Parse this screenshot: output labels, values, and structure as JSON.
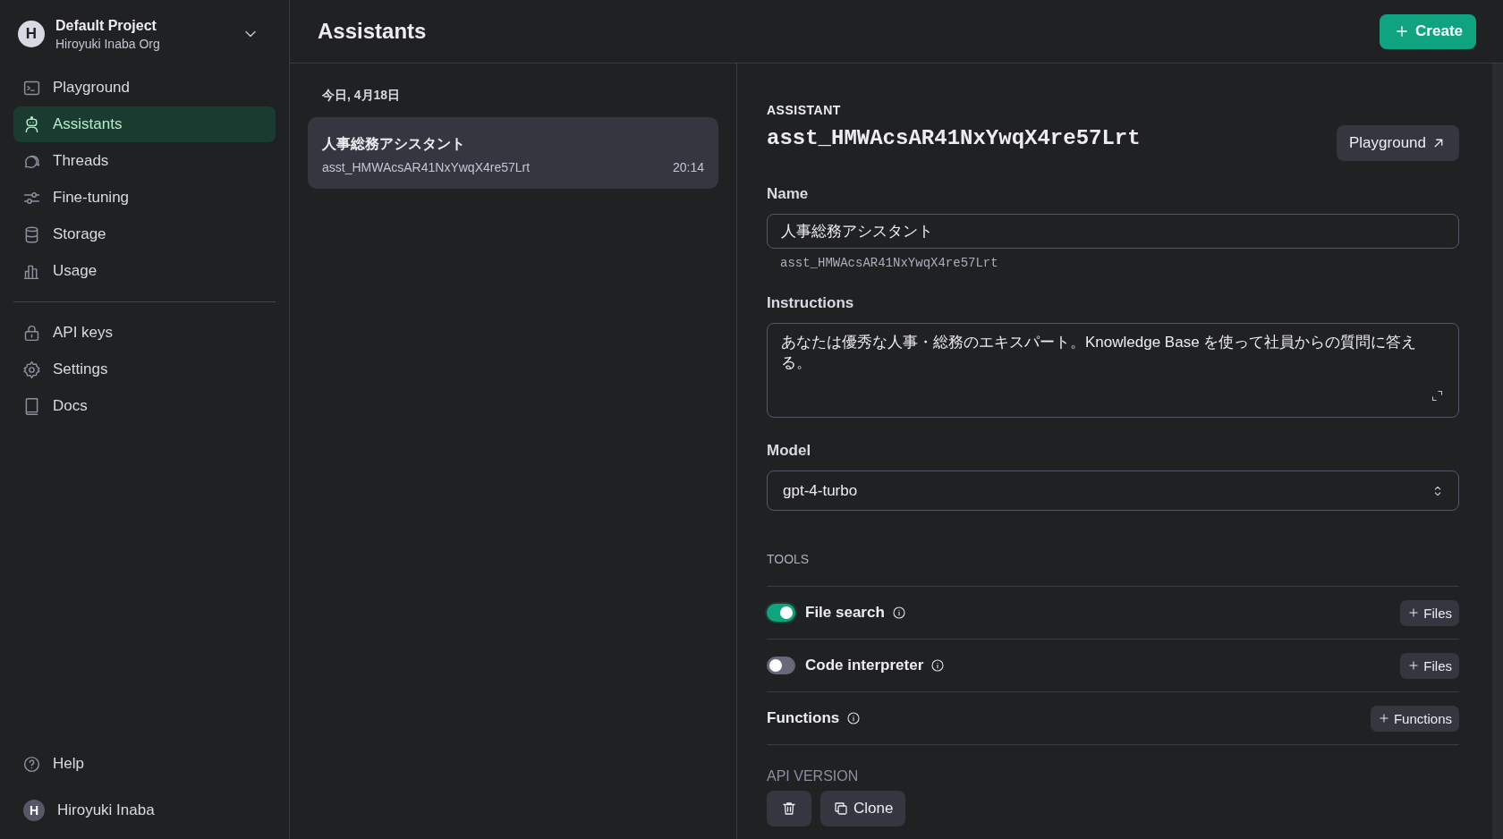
{
  "project": {
    "avatar": "H",
    "name": "Default Project",
    "org": "Hiroyuki Inaba Org"
  },
  "nav": [
    {
      "label": "Playground",
      "selected": false
    },
    {
      "label": "Assistants",
      "selected": true
    },
    {
      "label": "Threads",
      "selected": false
    },
    {
      "label": "Fine-tuning",
      "selected": false
    },
    {
      "label": "Storage",
      "selected": false
    },
    {
      "label": "Usage",
      "selected": false
    }
  ],
  "nav_secondary": [
    {
      "label": "API keys",
      "selected": false
    },
    {
      "label": "Settings",
      "selected": false
    },
    {
      "label": "Docs",
      "selected": false
    }
  ],
  "help": "Help",
  "user": {
    "avatar": "H",
    "name": "Hiroyuki Inaba"
  },
  "header": {
    "title": "Assistants",
    "create_button": "Create"
  },
  "list": {
    "date": "今日, 4月18日",
    "items": [
      {
        "name": "人事総務アシスタント",
        "id": "asst_HMWAcsAR41NxYwqX4re57Lrt",
        "time": "20:14",
        "selected": true
      }
    ]
  },
  "detail": {
    "section": "ASSISTANT",
    "id": "asst_HMWAcsAR41NxYwqX4re57Lrt",
    "playground_button": "Playground",
    "name_label": "Name",
    "name_value": "人事総務アシスタント",
    "name_id": "asst_HMWAcsAR41NxYwqX4re57Lrt",
    "instructions_label": "Instructions",
    "instructions_value": "あなたは優秀な人事・総務のエキスパート。Knowledge Base を使って社員からの質問に答える。",
    "model_label": "Model",
    "model_value": "gpt-4-turbo",
    "tools_label": "TOOLS",
    "tools": [
      {
        "kind": "toggle",
        "label": "File search",
        "on": true,
        "button": "Files"
      },
      {
        "kind": "toggle",
        "label": "Code interpreter",
        "on": false,
        "button": "Files"
      },
      {
        "kind": "plain",
        "label": "Functions",
        "button": "Functions"
      }
    ],
    "api_version_label": "API VERSION",
    "clone_button": "Clone"
  }
}
